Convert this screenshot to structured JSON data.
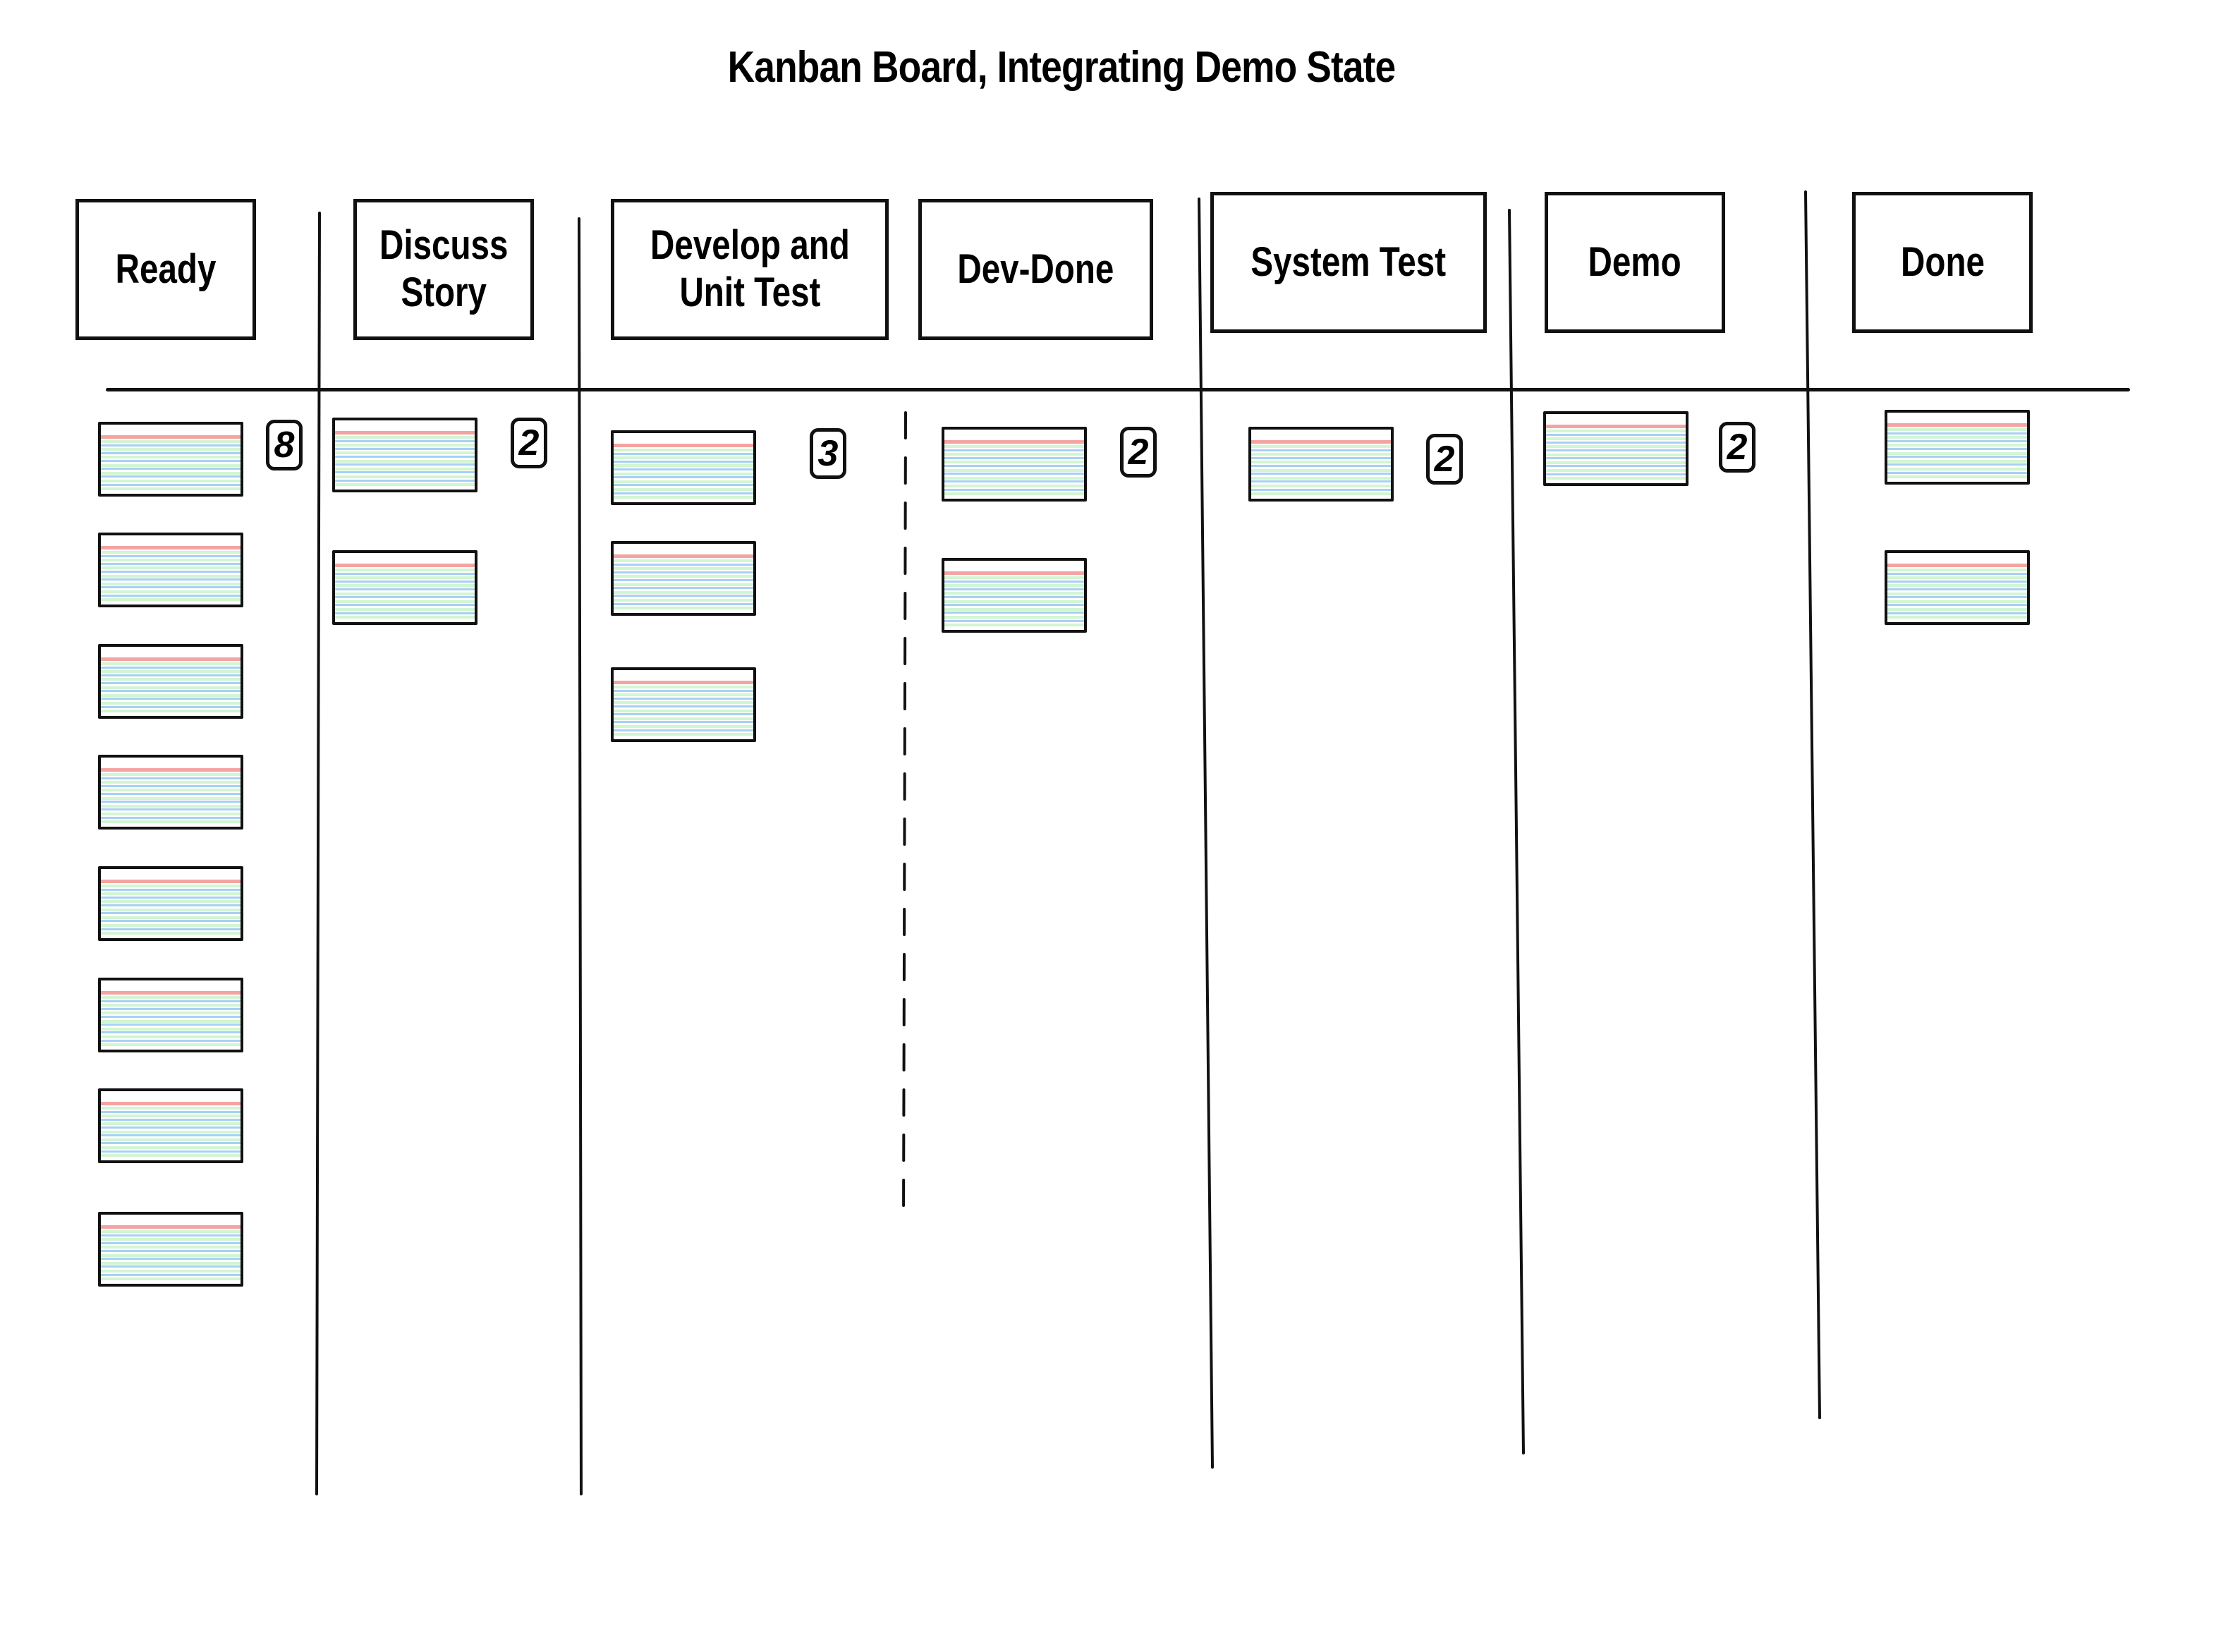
{
  "title": "Kanban Board, Integrating Demo State",
  "colors": {
    "ink": "#111111",
    "card_header_rule": "#f4a3a3",
    "card_rule_blue": "#a8d0f5",
    "card_rule_green": "#d2f5d2"
  },
  "columns": [
    {
      "id": "ready",
      "label": "Ready",
      "wip_limit": "8",
      "card_count": 8
    },
    {
      "id": "discuss-story",
      "label": "Discuss\nStory",
      "wip_limit": "2",
      "card_count": 2
    },
    {
      "id": "develop-unit-test",
      "label": "Develop and\nUnit Test",
      "wip_limit": "3",
      "card_count": 3
    },
    {
      "id": "dev-done",
      "label": "Dev-Done",
      "wip_limit": "2",
      "card_count": 2
    },
    {
      "id": "system-test",
      "label": "System Test",
      "wip_limit": "2",
      "card_count": 1
    },
    {
      "id": "demo",
      "label": "Demo",
      "wip_limit": "2",
      "card_count": 1
    },
    {
      "id": "done",
      "label": "Done",
      "wip_limit": null,
      "card_count": 2
    }
  ]
}
